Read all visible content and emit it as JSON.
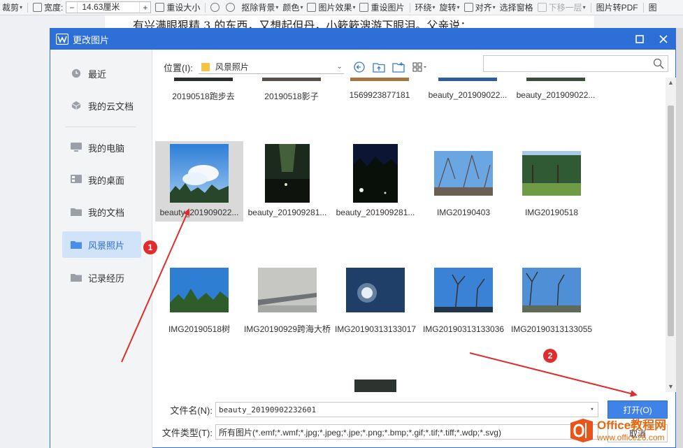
{
  "toolbar": {
    "crop_label": "裁剪",
    "width_label": "宽度:",
    "width_value": "14.63厘米",
    "minus": "−",
    "plus": "+",
    "reset_size": "重设大小",
    "remove_bg": "抠除背景",
    "color": "颜色",
    "effects": "图片效果",
    "reset_image": "重设图片",
    "wrap": "环绕",
    "rotate": "旋转",
    "align": "对齐",
    "selection_pane": "选择窗格",
    "move_down": "下移一层",
    "to_pdf": "图片转PDF",
    "more": "图"
  },
  "document": {
    "text": "有兴满眼狠精 3 的东西，又想起但丹，小簌簌溲游下眼泪。父亲说："
  },
  "dialog": {
    "title": "更改图片",
    "maximize_glyph": "□",
    "close_glyph": "✕"
  },
  "sidebar": {
    "items": [
      {
        "label": "最近",
        "icon": "clock-icon"
      },
      {
        "label": "我的云文档",
        "icon": "cloud-cube-icon"
      },
      {
        "label": "我的电脑",
        "icon": "monitor-icon"
      },
      {
        "label": "我的桌面",
        "icon": "desktop-icon"
      },
      {
        "label": "我的文档",
        "icon": "folder-icon"
      },
      {
        "label": "风景照片",
        "icon": "folder-icon",
        "active": true
      },
      {
        "label": "记录经历",
        "icon": "folder-icon"
      }
    ]
  },
  "location": {
    "label": "位置(I):",
    "value": "风景照片",
    "search_placeholder": ""
  },
  "files": {
    "top_row": [
      "20190518跑步去",
      "20190518影子",
      "1569923877181",
      "beauty_201909022...",
      "beauty_201909022..."
    ],
    "row1": [
      "beauty_201909022...",
      "beauty_201909281...",
      "beauty_201909281...",
      "IMG20190403",
      "IMG20190518"
    ],
    "row2": [
      "IMG20190518树",
      "IMG20190929跨海大桥",
      "IMG20190313133017",
      "IMG20190313133036",
      "IMG20190313133055"
    ]
  },
  "bottom": {
    "filename_label": "文件名(N):",
    "filename_value": "beauty_20190902232601",
    "filetype_label": "文件类型(T):",
    "filetype_value": "所有图片(*.emf;*.wmf;*.jpg;*.jpeg;*.jpe;*.png;*.bmp;*.gif;*.tif;*.tiff;*.wdp;*.svg)",
    "open_label": "打开(O)",
    "cancel_label": "取消"
  },
  "annotations": {
    "badge1": "1",
    "badge2": "2",
    "color": "#e02c2c"
  },
  "watermark": {
    "title": "Office教程网",
    "url": "www.office26.com"
  }
}
